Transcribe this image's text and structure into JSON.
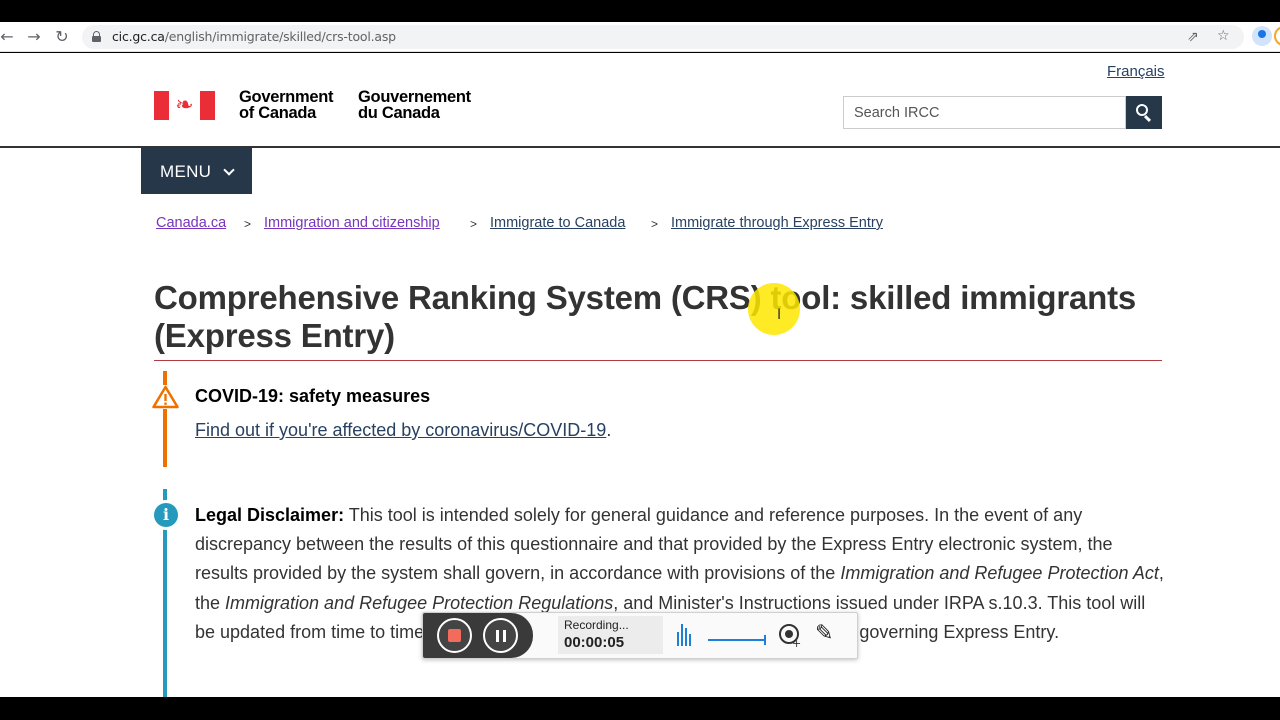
{
  "browser": {
    "url_host": "cic.gc.ca",
    "url_path": "/english/immigrate/skilled/crs-tool.asp",
    "back_icon": "←",
    "forward_icon": "→",
    "reload_icon": "↻",
    "share_icon": "⇗",
    "star_icon": "☆"
  },
  "header": {
    "language_link": "Français",
    "gov_en_line1": "Government",
    "gov_en_line2": "of Canada",
    "gov_fr_line1": "Gouvernement",
    "gov_fr_line2": "du Canada",
    "maple_leaf": "❧",
    "search_placeholder": "Search IRCC"
  },
  "menu": {
    "label": "MENU"
  },
  "breadcrumbs": [
    {
      "label": "Canada.ca"
    },
    {
      "label": "Immigration and citizenship"
    },
    {
      "label": "Immigrate to Canada"
    },
    {
      "label": "Immigrate through Express Entry"
    }
  ],
  "breadcrumb_separator": ">",
  "title": "Comprehensive Ranking System (CRS) tool: skilled immigrants (Express Entry)",
  "covid_alert": {
    "title": "COVID-19: safety measures",
    "link": "Find out if you're affected by coronavirus/COVID-19",
    "after_link": "."
  },
  "disclaimer": {
    "label": "Legal Disclaimer:",
    "text1": " This tool is intended solely for general guidance and reference purposes. In the event of any discrepancy between the results of this questionnaire and that provided by the Express Entry electronic system, the results provided by the system shall govern, in accordance with provisions of the ",
    "italic1": "Immigration and Refugee Protection Act",
    "text2": ", the ",
    "italic2": "Immigration and Refugee Protection Regulations",
    "text3": ", and Minister's Instructions issued under IRPA s.10.3. This tool will be updated from time to time in accordance with changes to Ministerial Instructions governing Express Entry."
  },
  "recorder": {
    "status": "Recording...",
    "time": "00:00:05",
    "info_glyph": "i",
    "pen_icon": "✎",
    "cursor_glyph": "I"
  },
  "colors": {
    "brand_navy": "#26374a",
    "link": "#284162",
    "visited_link": "#7834bc",
    "flag_red": "#eb2d37",
    "warning_orange": "#ee7100",
    "info_blue": "#269abc",
    "title_rule": "#af3c43"
  }
}
